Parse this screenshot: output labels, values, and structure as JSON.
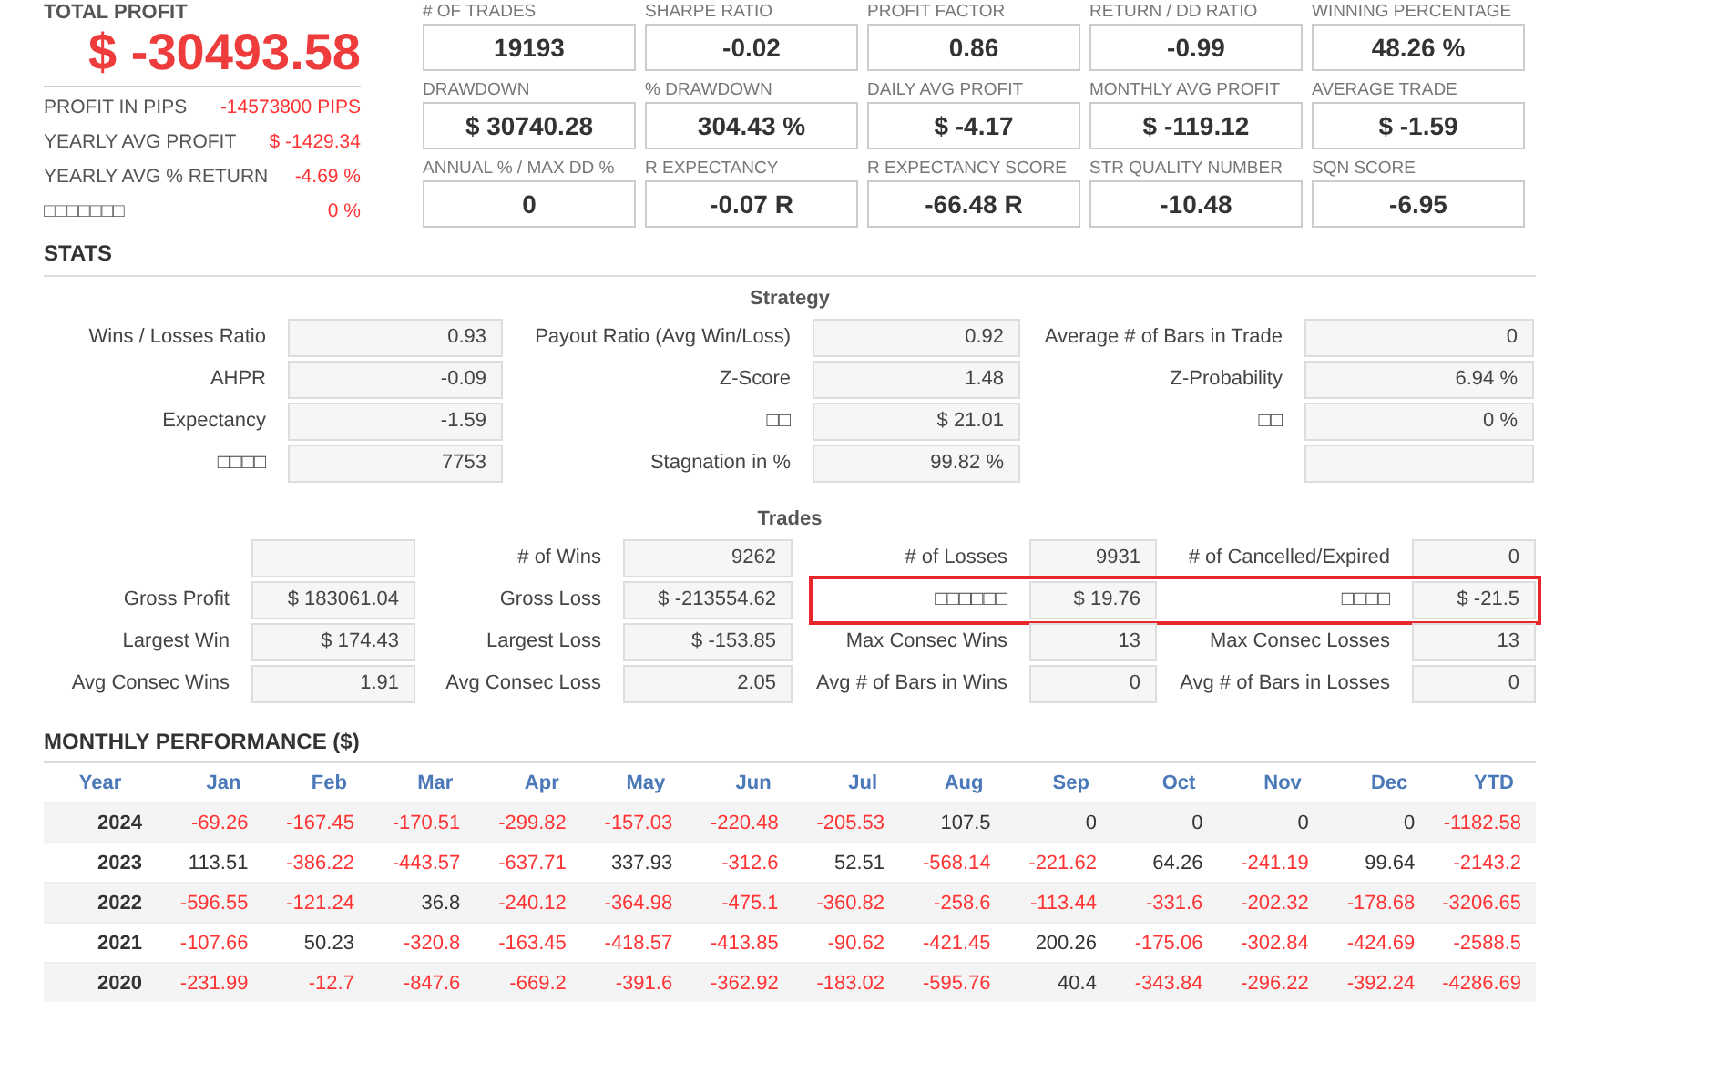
{
  "summary": {
    "title": "TOTAL PROFIT",
    "value": "$ -30493.58",
    "rows": [
      {
        "label": "PROFIT IN PIPS",
        "value": "-14573800 PIPS"
      },
      {
        "label": "YEARLY AVG PROFIT",
        "value": "$ -1429.34"
      },
      {
        "label": "YEARLY AVG % RETURN",
        "value": "-4.69 %"
      },
      {
        "label": "□□□□□□□",
        "value": "0 %"
      }
    ]
  },
  "metrics": [
    {
      "label": "# OF TRADES",
      "value": "19193"
    },
    {
      "label": "SHARPE RATIO",
      "value": "-0.02"
    },
    {
      "label": "PROFIT FACTOR",
      "value": "0.86"
    },
    {
      "label": "RETURN / DD RATIO",
      "value": "-0.99"
    },
    {
      "label": "WINNING PERCENTAGE",
      "value": "48.26 %"
    },
    {
      "label": "DRAWDOWN",
      "value": "$ 30740.28"
    },
    {
      "label": "% DRAWDOWN",
      "value": "304.43 %"
    },
    {
      "label": "DAILY AVG PROFIT",
      "value": "$ -4.17"
    },
    {
      "label": "MONTHLY AVG PROFIT",
      "value": "$ -119.12"
    },
    {
      "label": "AVERAGE TRADE",
      "value": "$ -1.59"
    },
    {
      "label": "ANNUAL % / MAX DD %",
      "value": "0"
    },
    {
      "label": "R EXPECTANCY",
      "value": "-0.07 R"
    },
    {
      "label": "R EXPECTANCY SCORE",
      "value": "-66.48 R"
    },
    {
      "label": "STR QUALITY NUMBER",
      "value": "-10.48"
    },
    {
      "label": "SQN SCORE",
      "value": "-6.95"
    }
  ],
  "stats": {
    "heading": "STATS",
    "strategy": {
      "title": "Strategy",
      "rows": [
        {
          "pairs": [
            {
              "kind": "stat",
              "label": "Wins / Losses Ratio",
              "value": "0.93"
            },
            {
              "kind": "stat",
              "label": "Payout Ratio (Avg Win/Loss)",
              "value": "0.92"
            },
            {
              "kind": "stat",
              "label": "Average # of Bars in Trade",
              "value": "0"
            }
          ]
        },
        {
          "pairs": [
            {
              "kind": "stat",
              "label": "AHPR",
              "value": "-0.09"
            },
            {
              "kind": "stat",
              "label": "Z-Score",
              "value": "1.48"
            },
            {
              "kind": "stat",
              "label": "Z-Probability",
              "value": "6.94 %"
            }
          ]
        },
        {
          "pairs": [
            {
              "kind": "stat",
              "label": "Expectancy",
              "value": "-1.59"
            },
            {
              "kind": "stat",
              "label": "□□",
              "value": "$ 21.01"
            },
            {
              "kind": "stat",
              "label": "□□",
              "value": "0 %"
            }
          ]
        },
        {
          "pairs": [
            {
              "kind": "stat",
              "label": "□□□□",
              "value": "7753"
            },
            {
              "kind": "stat",
              "label": "Stagnation in %",
              "value": "99.82 %"
            },
            {
              "kind": "blank"
            }
          ]
        }
      ]
    },
    "trades": {
      "title": "Trades",
      "rows": [
        {
          "highlighted": false,
          "pairs": [
            {
              "kind": "blank"
            },
            {
              "kind": "stat",
              "label": "# of Wins",
              "value": "9262"
            },
            {
              "kind": "stat",
              "label": "# of Losses",
              "value": "9931"
            },
            {
              "kind": "stat",
              "label": "# of Cancelled/Expired",
              "value": "0"
            }
          ]
        },
        {
          "highlighted": true,
          "pairs": [
            {
              "kind": "stat",
              "label": "Gross Profit",
              "value": "$ 183061.04"
            },
            {
              "kind": "stat",
              "label": "Gross Loss",
              "value": "$ -213554.62"
            },
            {
              "kind": "stat",
              "label": "□□□□□□",
              "value": "$ 19.76"
            },
            {
              "kind": "stat",
              "label": "□□□□",
              "value": "$ -21.5"
            }
          ]
        },
        {
          "highlighted": false,
          "pairs": [
            {
              "kind": "stat",
              "label": "Largest Win",
              "value": "$ 174.43"
            },
            {
              "kind": "stat",
              "label": "Largest Loss",
              "value": "$ -153.85"
            },
            {
              "kind": "stat",
              "label": "Max Consec Wins",
              "value": "13"
            },
            {
              "kind": "stat",
              "label": "Max Consec Losses",
              "value": "13"
            }
          ]
        },
        {
          "highlighted": false,
          "pairs": [
            {
              "kind": "stat",
              "label": "Avg Consec Wins",
              "value": "1.91"
            },
            {
              "kind": "stat",
              "label": "Avg Consec Loss",
              "value": "2.05"
            },
            {
              "kind": "stat",
              "label": "Avg # of Bars in Wins",
              "value": "0"
            },
            {
              "kind": "stat",
              "label": "Avg # of Bars in Losses",
              "value": "0"
            }
          ]
        }
      ]
    }
  },
  "monthly": {
    "heading": "MONTHLY PERFORMANCE ($)",
    "columns": [
      "Year",
      "Jan",
      "Feb",
      "Mar",
      "Apr",
      "May",
      "Jun",
      "Jul",
      "Aug",
      "Sep",
      "Oct",
      "Nov",
      "Dec",
      "YTD"
    ],
    "rows": [
      {
        "cells": [
          {
            "kind": "year",
            "text": "2024"
          },
          {
            "kind": "amount",
            "text": "-69.26",
            "negative": true
          },
          {
            "kind": "amount",
            "text": "-167.45",
            "negative": true
          },
          {
            "kind": "amount",
            "text": "-170.51",
            "negative": true
          },
          {
            "kind": "amount",
            "text": "-299.82",
            "negative": true
          },
          {
            "kind": "amount",
            "text": "-157.03",
            "negative": true
          },
          {
            "kind": "amount",
            "text": "-220.48",
            "negative": true
          },
          {
            "kind": "amount",
            "text": "-205.53",
            "negative": true
          },
          {
            "kind": "amount",
            "text": "107.5",
            "negative": false
          },
          {
            "kind": "amount",
            "text": "0",
            "negative": false
          },
          {
            "kind": "amount",
            "text": "0",
            "negative": false
          },
          {
            "kind": "amount",
            "text": "0",
            "negative": false
          },
          {
            "kind": "amount",
            "text": "0",
            "negative": false
          },
          {
            "kind": "amount",
            "text": "-1182.58",
            "negative": true
          }
        ]
      },
      {
        "cells": [
          {
            "kind": "year",
            "text": "2023"
          },
          {
            "kind": "amount",
            "text": "113.51",
            "negative": false
          },
          {
            "kind": "amount",
            "text": "-386.22",
            "negative": true
          },
          {
            "kind": "amount",
            "text": "-443.57",
            "negative": true
          },
          {
            "kind": "amount",
            "text": "-637.71",
            "negative": true
          },
          {
            "kind": "amount",
            "text": "337.93",
            "negative": false
          },
          {
            "kind": "amount",
            "text": "-312.6",
            "negative": true
          },
          {
            "kind": "amount",
            "text": "52.51",
            "negative": false
          },
          {
            "kind": "amount",
            "text": "-568.14",
            "negative": true
          },
          {
            "kind": "amount",
            "text": "-221.62",
            "negative": true
          },
          {
            "kind": "amount",
            "text": "64.26",
            "negative": false
          },
          {
            "kind": "amount",
            "text": "-241.19",
            "negative": true
          },
          {
            "kind": "amount",
            "text": "99.64",
            "negative": false
          },
          {
            "kind": "amount",
            "text": "-2143.2",
            "negative": true
          }
        ]
      },
      {
        "cells": [
          {
            "kind": "year",
            "text": "2022"
          },
          {
            "kind": "amount",
            "text": "-596.55",
            "negative": true
          },
          {
            "kind": "amount",
            "text": "-121.24",
            "negative": true
          },
          {
            "kind": "amount",
            "text": "36.8",
            "negative": false
          },
          {
            "kind": "amount",
            "text": "-240.12",
            "negative": true
          },
          {
            "kind": "amount",
            "text": "-364.98",
            "negative": true
          },
          {
            "kind": "amount",
            "text": "-475.1",
            "negative": true
          },
          {
            "kind": "amount",
            "text": "-360.82",
            "negative": true
          },
          {
            "kind": "amount",
            "text": "-258.6",
            "negative": true
          },
          {
            "kind": "amount",
            "text": "-113.44",
            "negative": true
          },
          {
            "kind": "amount",
            "text": "-331.6",
            "negative": true
          },
          {
            "kind": "amount",
            "text": "-202.32",
            "negative": true
          },
          {
            "kind": "amount",
            "text": "-178.68",
            "negative": true
          },
          {
            "kind": "amount",
            "text": "-3206.65",
            "negative": true
          }
        ]
      },
      {
        "cells": [
          {
            "kind": "year",
            "text": "2021"
          },
          {
            "kind": "amount",
            "text": "-107.66",
            "negative": true
          },
          {
            "kind": "amount",
            "text": "50.23",
            "negative": false
          },
          {
            "kind": "amount",
            "text": "-320.8",
            "negative": true
          },
          {
            "kind": "amount",
            "text": "-163.45",
            "negative": true
          },
          {
            "kind": "amount",
            "text": "-418.57",
            "negative": true
          },
          {
            "kind": "amount",
            "text": "-413.85",
            "negative": true
          },
          {
            "kind": "amount",
            "text": "-90.62",
            "negative": true
          },
          {
            "kind": "amount",
            "text": "-421.45",
            "negative": true
          },
          {
            "kind": "amount",
            "text": "200.26",
            "negative": false
          },
          {
            "kind": "amount",
            "text": "-175.06",
            "negative": true
          },
          {
            "kind": "amount",
            "text": "-302.84",
            "negative": true
          },
          {
            "kind": "amount",
            "text": "-424.69",
            "negative": true
          },
          {
            "kind": "amount",
            "text": "-2588.5",
            "negative": true
          }
        ]
      },
      {
        "cells": [
          {
            "kind": "year",
            "text": "2020"
          },
          {
            "kind": "amount",
            "text": "-231.99",
            "negative": true
          },
          {
            "kind": "amount",
            "text": "-12.7",
            "negative": true
          },
          {
            "kind": "amount",
            "text": "-847.6",
            "negative": true
          },
          {
            "kind": "amount",
            "text": "-669.2",
            "negative": true
          },
          {
            "kind": "amount",
            "text": "-391.6",
            "negative": true
          },
          {
            "kind": "amount",
            "text": "-362.92",
            "negative": true
          },
          {
            "kind": "amount",
            "text": "-183.02",
            "negative": true
          },
          {
            "kind": "amount",
            "text": "-595.76",
            "negative": true
          },
          {
            "kind": "amount",
            "text": "40.4",
            "negative": false
          },
          {
            "kind": "amount",
            "text": "-343.84",
            "negative": true
          },
          {
            "kind": "amount",
            "text": "-296.22",
            "negative": true
          },
          {
            "kind": "amount",
            "text": "-392.24",
            "negative": true
          },
          {
            "kind": "amount",
            "text": "-4286.69",
            "negative": true
          }
        ]
      }
    ]
  }
}
